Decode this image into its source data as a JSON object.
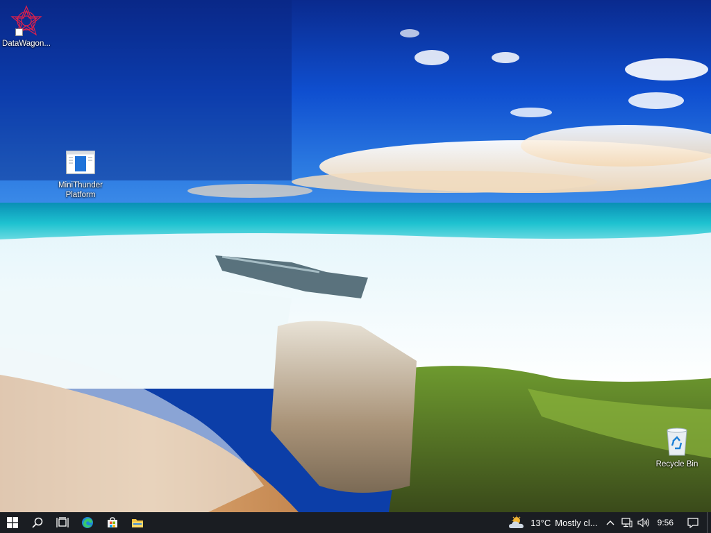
{
  "desktop": {
    "icons": [
      {
        "label": "DataWagon..."
      },
      {
        "label": "MiniThunder Platform"
      },
      {
        "label": "Recycle Bin"
      }
    ]
  },
  "taskbar": {
    "start_icon": "windows-logo-icon",
    "search_icon": "search-icon",
    "taskview_icon": "task-view-icon",
    "pinned": [
      "edge-icon",
      "store-icon",
      "file-explorer-icon"
    ],
    "weather": {
      "temperature": "13°C",
      "condition": "Mostly cl...",
      "icon": "partly-cloudy-icon"
    },
    "tray": {
      "overflow_icon": "chevron-up-icon",
      "network_icon": "network-icon",
      "volume_icon": "volume-icon"
    },
    "clock": "9:56",
    "notification_icon": "notification-icon"
  },
  "colors": {
    "taskbar_bg": "#1a1d22",
    "sky_top": "#0b2f9a",
    "sea": "#16b6c8",
    "sand": "#d9a36b"
  }
}
